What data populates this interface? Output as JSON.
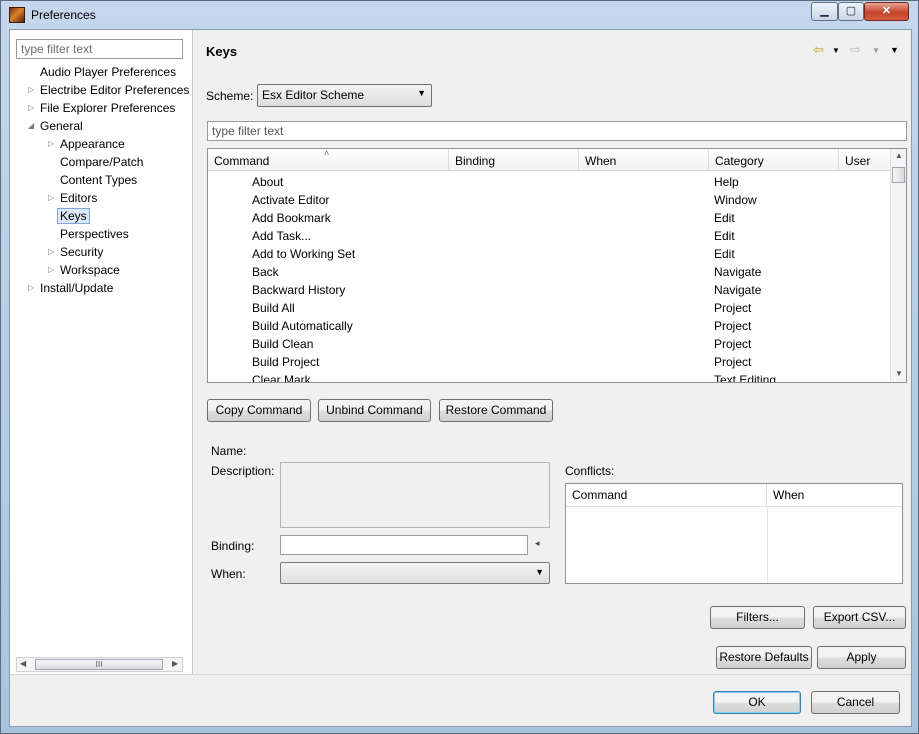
{
  "window": {
    "title": "Preferences"
  },
  "tree": {
    "filter_placeholder": "type filter text",
    "items": [
      {
        "label": "Audio Player Preferences",
        "level": 0,
        "expander": ""
      },
      {
        "label": "Electribe Editor Preferences",
        "level": 0,
        "expander": "▷"
      },
      {
        "label": "File Explorer Preferences",
        "level": 0,
        "expander": "▷"
      },
      {
        "label": "General",
        "level": 0,
        "expander": "◢"
      },
      {
        "label": "Appearance",
        "level": 1,
        "expander": "▷"
      },
      {
        "label": "Compare/Patch",
        "level": 1,
        "expander": ""
      },
      {
        "label": "Content Types",
        "level": 1,
        "expander": ""
      },
      {
        "label": "Editors",
        "level": 1,
        "expander": "▷"
      },
      {
        "label": "Keys",
        "level": 1,
        "expander": "",
        "selected": true
      },
      {
        "label": "Perspectives",
        "level": 1,
        "expander": ""
      },
      {
        "label": "Security",
        "level": 1,
        "expander": "▷"
      },
      {
        "label": "Workspace",
        "level": 1,
        "expander": "▷"
      },
      {
        "label": "Install/Update",
        "level": 0,
        "expander": "▷"
      }
    ],
    "scroll_thumb": "III"
  },
  "page": {
    "title": "Keys",
    "scheme_label": "Scheme:",
    "scheme_value": "Esx Editor Scheme",
    "filter_placeholder": "type filter text"
  },
  "table": {
    "columns": [
      "Command",
      "Binding",
      "When",
      "Category",
      "User"
    ],
    "rows": [
      {
        "command": "About",
        "category": "Help"
      },
      {
        "command": "Activate Editor",
        "category": "Window"
      },
      {
        "command": "Add Bookmark",
        "category": "Edit"
      },
      {
        "command": "Add Task...",
        "category": "Edit"
      },
      {
        "command": "Add to Working Set",
        "category": "Edit"
      },
      {
        "command": "Back",
        "category": "Navigate"
      },
      {
        "command": "Backward History",
        "category": "Navigate"
      },
      {
        "command": "Build All",
        "category": "Project"
      },
      {
        "command": "Build Automatically",
        "category": "Project"
      },
      {
        "command": "Build Clean",
        "category": "Project"
      },
      {
        "command": "Build Project",
        "category": "Project"
      },
      {
        "command": "Clear Mark",
        "category": "Text Editing"
      }
    ]
  },
  "buttons": {
    "copy_command": "Copy Command",
    "unbind_command": "Unbind Command",
    "restore_command": "Restore Command",
    "filters": "Filters...",
    "export_csv": "Export CSV...",
    "restore_defaults": "Restore Defaults",
    "apply": "Apply",
    "ok": "OK",
    "cancel": "Cancel"
  },
  "details": {
    "name_label": "Name:",
    "description_label": "Description:",
    "binding_label": "Binding:",
    "when_label": "When:",
    "conflicts_label": "Conflicts:",
    "conflicts_columns": [
      "Command",
      "When"
    ]
  }
}
